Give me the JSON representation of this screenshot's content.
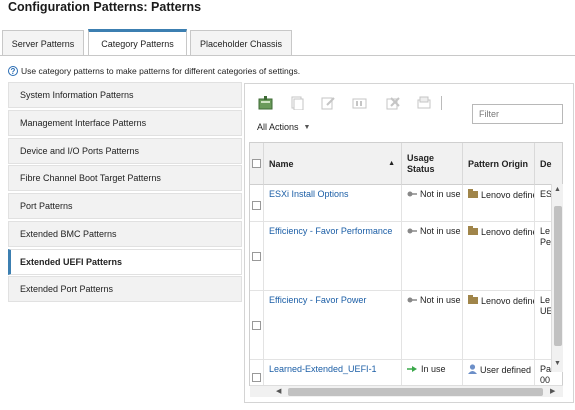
{
  "page": {
    "title": "Configuration Patterns: Patterns"
  },
  "tabs": [
    {
      "label": "Server Patterns",
      "active": false
    },
    {
      "label": "Category Patterns",
      "active": true
    },
    {
      "label": "Placeholder Chassis",
      "active": false
    }
  ],
  "help_text": "Use category patterns to make patterns for different categories of settings.",
  "sidebar": {
    "items": [
      {
        "label": "System Information Patterns",
        "active": false
      },
      {
        "label": "Management Interface Patterns",
        "active": false
      },
      {
        "label": "Device and I/O Ports Patterns",
        "active": false
      },
      {
        "label": "Fibre Channel Boot Target Patterns",
        "active": false
      },
      {
        "label": "Port Patterns",
        "active": false
      },
      {
        "label": "Extended BMC Patterns",
        "active": false
      },
      {
        "label": "Extended UEFI Patterns",
        "active": true
      },
      {
        "label": "Extended Port Patterns",
        "active": false
      }
    ]
  },
  "toolbar": {
    "icons": [
      "create-icon",
      "copy-icon",
      "edit-icon",
      "deploy-icon",
      "remove-icon",
      "export-icon"
    ],
    "all_actions_label": "All Actions",
    "filter_placeholder": "Filter"
  },
  "table": {
    "columns": [
      "Name",
      "Usage Status",
      "Pattern Origin",
      "De"
    ],
    "rows": [
      {
        "name": "ESXi Install Options",
        "usage": "Not in use",
        "origin": "Lenovo define",
        "desc1": "ES",
        "desc2": ""
      },
      {
        "name": "Efficiency - Favor Performance",
        "usage": "Not in use",
        "origin": "Lenovo define",
        "desc1": "Le",
        "desc2": "Pe"
      },
      {
        "name": "Efficiency - Favor Power",
        "usage": "Not in use",
        "origin": "Lenovo define",
        "desc1": "Le",
        "desc2": "UE"
      },
      {
        "name": "Learned-Extended_UEFI-1",
        "usage": "In use",
        "origin": "User defined",
        "desc1": "Pa",
        "desc2": "00"
      }
    ]
  },
  "colors": {
    "accent": "#3c7fb1",
    "link": "#1b5ea6",
    "folder": "#a0854a",
    "user": "#6c8fc8",
    "in_use": "#3aa84a"
  }
}
